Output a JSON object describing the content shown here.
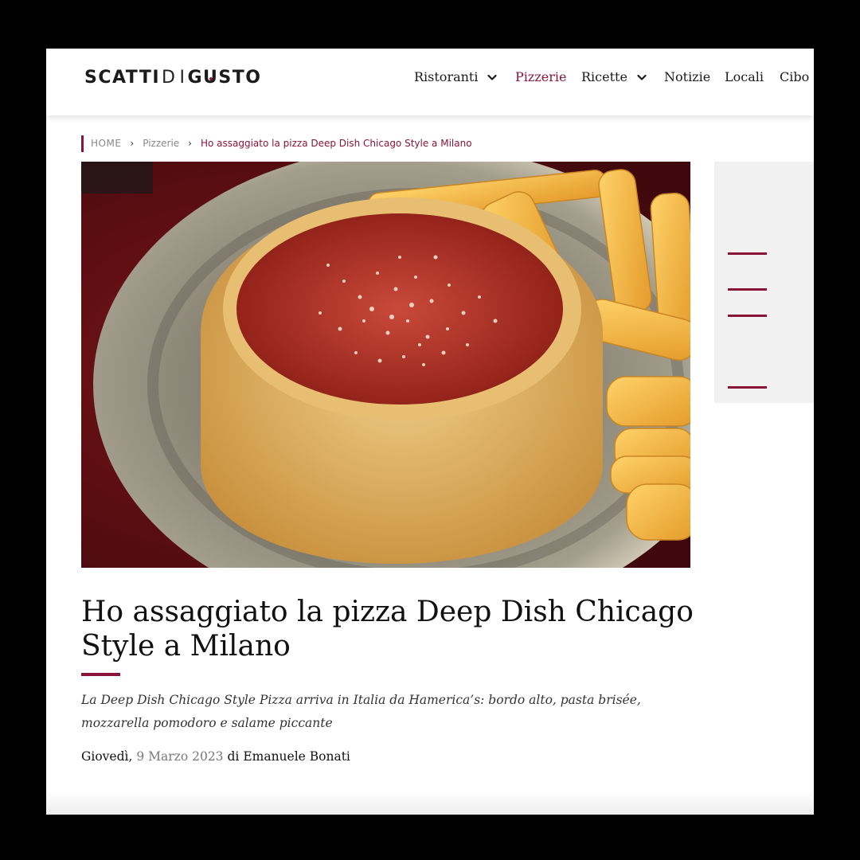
{
  "header": {
    "logo": {
      "part1": "SCATTI",
      "sep": "D",
      "i": "I",
      "part2a": "G",
      "u": "U",
      "part2b": "STO"
    },
    "nav": [
      {
        "label": "Ristoranti",
        "has_dropdown": true,
        "active": false
      },
      {
        "label": "Pizzerie",
        "has_dropdown": false,
        "active": true
      },
      {
        "label": "Ricette",
        "has_dropdown": true,
        "active": false
      },
      {
        "label": "Notizie",
        "has_dropdown": false,
        "active": false
      },
      {
        "label": "Locali",
        "has_dropdown": false,
        "active": false
      },
      {
        "label": "Cibo",
        "has_dropdown": false,
        "active": false
      }
    ],
    "dropdown_icon": "chevron-down-icon"
  },
  "breadcrumb": {
    "home": "HOME",
    "separator": "›",
    "section": "Pizzerie",
    "current": "Ho assaggiato la pizza Deep Dish Chicago Style a Milano"
  },
  "hero_image": {
    "subject": "deep-dish-pizza-with-fries-photo"
  },
  "article": {
    "title": "Ho assaggiato la pizza Deep Dish Chicago Style a Milano",
    "subtitle": "La Deep Dish Chicago Style Pizza arriva in Italia da Hamerica’s: bordo alto, pasta brisée, mozzarella pomodoro e salame piccante",
    "byline": {
      "day": "Giovedì,",
      "date": "9 Marzo 2023",
      "by": "di",
      "author": "Emanuele Bonati"
    }
  },
  "colors": {
    "accent": "#8a1438",
    "text": "#111111",
    "muted": "#777777",
    "sidebar_bg": "#f1f1f2",
    "frame": "#000000"
  }
}
